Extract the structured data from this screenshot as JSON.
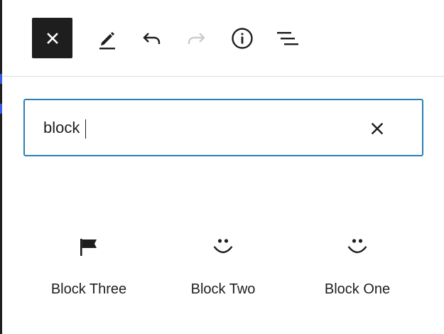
{
  "toolbar": {
    "close_icon": "close-icon",
    "edit_icon": "pencil-icon",
    "undo_icon": "undo-icon",
    "redo_icon": "redo-icon",
    "info_icon": "info-icon",
    "outline_icon": "list-view-icon",
    "redo_disabled": true,
    "colors": {
      "close_bg": "#1e1e1e",
      "icon": "#1e1e1e",
      "disabled_icon": "#cccccc"
    }
  },
  "search": {
    "value": "block",
    "placeholder": "",
    "clear_icon": "close-icon",
    "border_color": "#2a7fb6"
  },
  "blocks": [
    {
      "label": "Block Three",
      "icon": "flag-icon"
    },
    {
      "label": "Block Two",
      "icon": "smiley-icon"
    },
    {
      "label": "Block One",
      "icon": "smiley-icon"
    }
  ]
}
